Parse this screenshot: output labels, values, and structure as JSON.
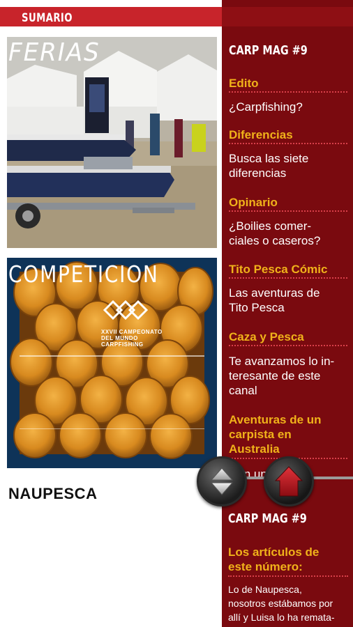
{
  "header": {
    "label": "SUMARIO"
  },
  "thumbnails": [
    {
      "label": "FERIAS"
    },
    {
      "label": "COMPETICION"
    }
  ],
  "competition_poster": {
    "line1": "XXVII CAMPEONATO",
    "line2": "DEL MUNDO",
    "line3": "CARPFISHING"
  },
  "brand": {
    "label": "NAUPESCA"
  },
  "sidebar": {
    "title": "CARP MAG #9",
    "items": [
      {
        "heading": "Edito",
        "text": "¿Carpfishing?"
      },
      {
        "heading": "Diferencias",
        "text_lines": [
          "Busca las siete",
          "diferencias"
        ]
      },
      {
        "heading": "Opinario",
        "text_lines": [
          "¿Boilies comer-",
          "ciales o caseros?"
        ]
      },
      {
        "heading": "Tito Pesca Cómic",
        "text_lines": [
          "Las aventuras de",
          "Tito Pesca"
        ]
      },
      {
        "heading": "Caza y Pesca",
        "text_lines": [
          "Te avanzamos lo in-",
          "teresante de este",
          "canal"
        ]
      },
      {
        "heading_lines": [
          "Aventuras de un",
          "carpista en",
          "Australia"
        ],
        "text": "Con un..."
      }
    ]
  },
  "lower_panel": {
    "title": "CARP MAG #9",
    "heading_lines": [
      "Los artículos de",
      "este número:"
    ],
    "text_lines": [
      "Lo de Naupesca,",
      "nosotros estábamos por",
      "allí y Luisa lo ha remata-"
    ]
  },
  "controls": {
    "scroll_icon": "up-down-arrows-icon",
    "home_icon": "home-icon"
  },
  "colors": {
    "accent_red": "#c8242b",
    "sidebar_bg": "#7a0a0f",
    "heading_gold": "#f0b21a"
  }
}
